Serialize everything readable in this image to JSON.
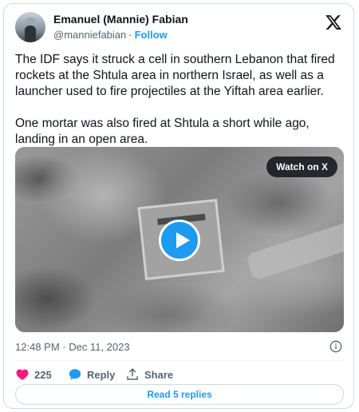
{
  "author": {
    "name": "Emanuel (Mannie) Fabian",
    "handle": "@manniefabian",
    "separator": "·",
    "follow_label": "Follow"
  },
  "tweet": {
    "paragraph1": "The IDF says it struck a cell in southern Lebanon that fired rockets at the Shtula area in northern Israel, as well as a launcher used to fire projectiles at the Yiftah area earlier.",
    "paragraph2": "One mortar was also fired at Shtula a short while ago, landing in an open area."
  },
  "media": {
    "watch_label": "Watch on X"
  },
  "meta": {
    "timestamp": "12:48 PM · Dec 11, 2023"
  },
  "actions": {
    "likes_count": "225",
    "reply_label": "Reply",
    "share_label": "Share",
    "read_replies_label": "Read 5 replies"
  },
  "colors": {
    "accent": "#1d9bf0",
    "like": "#f91880",
    "muted": "#536471",
    "text": "#0f1419"
  },
  "icons": [
    "x-logo-icon",
    "play-icon",
    "info-icon",
    "heart-icon",
    "reply-bubble-icon",
    "share-icon"
  ]
}
